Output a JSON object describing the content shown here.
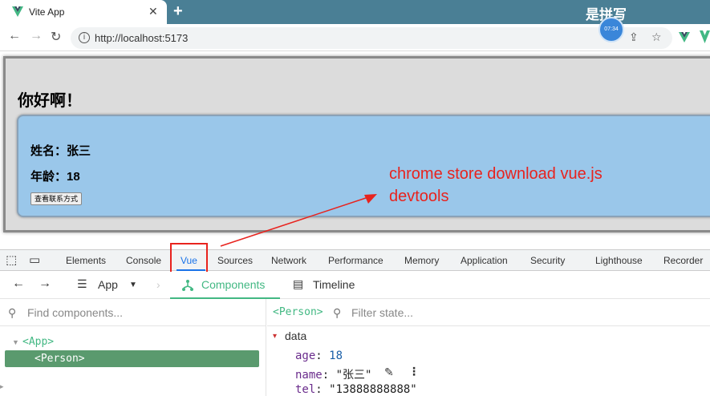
{
  "browser": {
    "tab_title": "Vite App",
    "tab_close": "✕",
    "new_tab": "+",
    "url": "http://localhost:5173",
    "watermark": "是拼写",
    "avatar_text": "07:34"
  },
  "page": {
    "heading": "你好啊！",
    "name_line": "姓名：张三",
    "age_line": "年龄：18",
    "contact_button": "查看联系方式"
  },
  "annotation": {
    "text": "chrome store download vue.js devtools",
    "color": "#e8231e"
  },
  "devtools": {
    "tabs": [
      "Elements",
      "Console",
      "Vue",
      "Sources",
      "Network",
      "Performance",
      "Memory",
      "Application",
      "Security",
      "Lighthouse",
      "Recorder"
    ],
    "active_tab": "Vue",
    "vue": {
      "app_selector": "App",
      "components_tab": "Components",
      "timeline_tab": "Timeline",
      "find_placeholder": "Find components...",
      "filter_placeholder": "Filter state...",
      "tree": {
        "root": "<App>",
        "child": "<Person>"
      },
      "selected_component": "<Person>",
      "state": {
        "section": "data",
        "props": [
          {
            "key": "age",
            "value": "18"
          },
          {
            "key": "name",
            "value": "\"张三\""
          },
          {
            "key": "tel",
            "value": "\"13888888888\""
          }
        ]
      }
    }
  },
  "colors": {
    "tabstrip": "#4a7f95",
    "vue_green": "#42b883",
    "person_bg": "#9ac7ea",
    "selected_row": "#5a9a6e"
  }
}
